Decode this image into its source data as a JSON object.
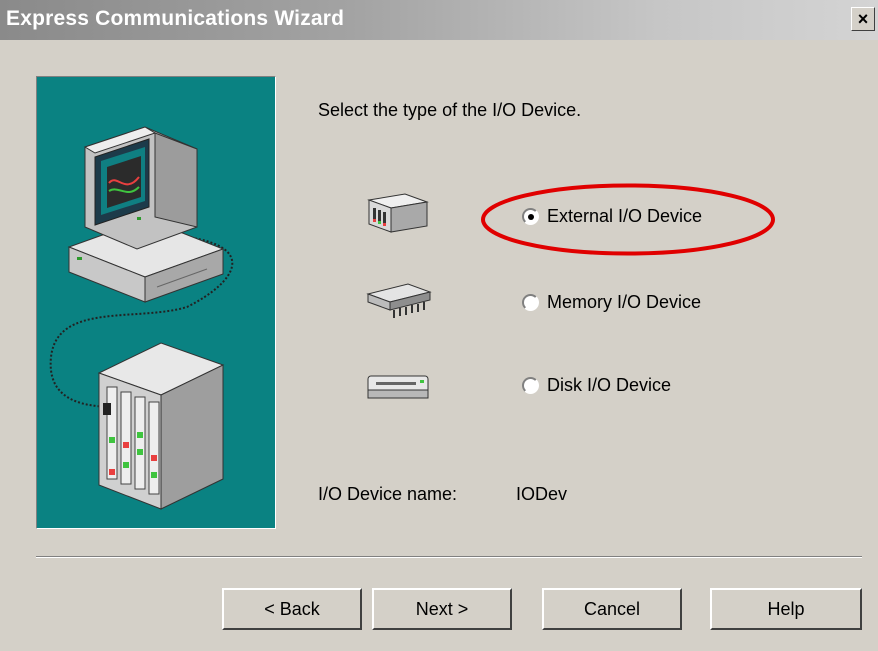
{
  "window": {
    "title": "Express Communications Wizard",
    "close_glyph": "×"
  },
  "main": {
    "prompt": "Select the type of the I/O Device.",
    "options": [
      {
        "label": "External I/O Device",
        "icon": "external-io-device-icon",
        "selected": true,
        "highlighted": true
      },
      {
        "label": "Memory I/O Device",
        "icon": "memory-chip-icon",
        "selected": false
      },
      {
        "label": "Disk I/O Device",
        "icon": "disk-drive-icon",
        "selected": false
      }
    ],
    "device_name_label": "I/O Device name:",
    "device_name_value": "IODev"
  },
  "buttons": {
    "back": "< Back",
    "next": "Next >",
    "cancel": "Cancel",
    "help": "Help"
  },
  "colors": {
    "illustration_bg": "#0a8282",
    "dialog_bg": "#d4d0c8",
    "highlight": "#e00000"
  }
}
